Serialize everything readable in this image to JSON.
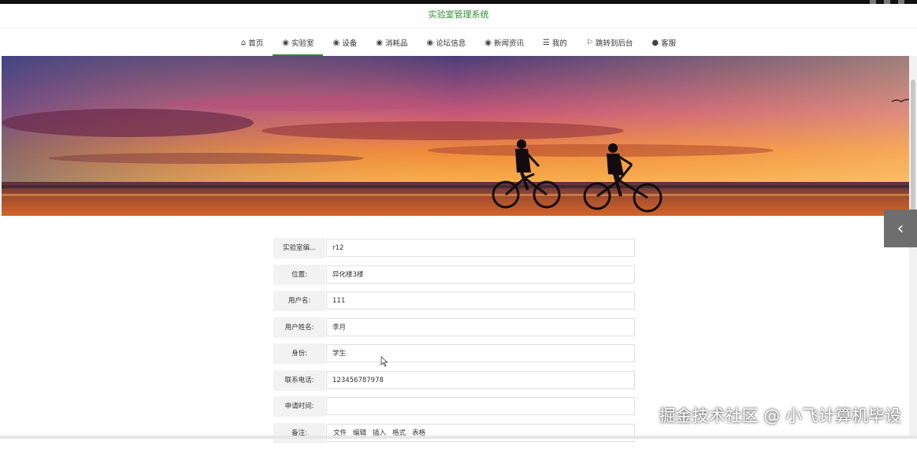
{
  "app": {
    "title": "实验室管理系统"
  },
  "nav": {
    "items": [
      {
        "label": "首页",
        "icon": "home-icon"
      },
      {
        "label": "实验室",
        "icon": "stack-icon",
        "active": true
      },
      {
        "label": "设备",
        "icon": "stack-icon"
      },
      {
        "label": "消耗品",
        "icon": "stack-icon"
      },
      {
        "label": "论坛信息",
        "icon": "stack-icon"
      },
      {
        "label": "新闻资讯",
        "icon": "stack-icon"
      },
      {
        "label": "我的",
        "icon": "list-icon"
      },
      {
        "label": "跳转到后台",
        "icon": "flag-icon"
      },
      {
        "label": "客服",
        "icon": "support-icon"
      }
    ]
  },
  "form": {
    "fields": [
      {
        "label": "实验室编...",
        "value": "r12"
      },
      {
        "label": "位置:",
        "value": "异化楼3楼"
      },
      {
        "label": "用户名:",
        "value": "111"
      },
      {
        "label": "用户姓名:",
        "value": "李月"
      },
      {
        "label": "身份:",
        "value": "学生"
      },
      {
        "label": "联系电话:",
        "value": "123456787978"
      },
      {
        "label": "申请时间:",
        "value": ""
      }
    ],
    "remark": {
      "label": "备注:",
      "toolbar": [
        "文件",
        "编辑",
        "插入",
        "格式",
        "表格"
      ]
    }
  },
  "watermark": "掘金技术社区 @ 小飞计算机毕设",
  "colors": {
    "accent": "#2e8b2e",
    "toggle": "#6e6e6e"
  }
}
